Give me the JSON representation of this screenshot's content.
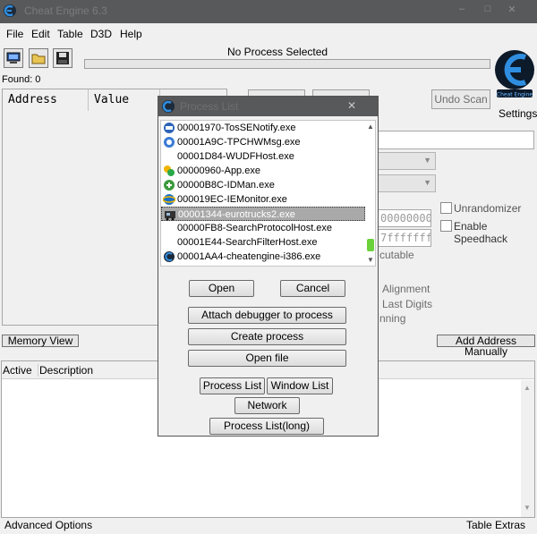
{
  "window": {
    "title": "Cheat Engine 6.3",
    "minimize": "–",
    "maximize": "□",
    "close": "✕"
  },
  "menu": [
    "File",
    "Edit",
    "Table",
    "D3D",
    "Help"
  ],
  "toolbar": {
    "open_process_icon": "computer-icon",
    "open_file_icon": "folder-icon",
    "save_icon": "floppy-icon"
  },
  "process_label": "No Process Selected",
  "found": "Found: 0",
  "results_columns": [
    "Address",
    "Value"
  ],
  "undo_scan": "Undo Scan",
  "settings": "Settings",
  "logo_text": "Cheat Engine",
  "background": {
    "hex_a": "00000000",
    "hex_b": "7fffffff",
    "executable_frag": "cutable",
    "alignment_frag": "Alignment",
    "last_digits_frag": "Last Digits",
    "scanning_frag": "nning",
    "unrandomizer": "Unrandomizer",
    "enable_speedhack": "Enable Speedhack"
  },
  "memory_view": "Memory View",
  "add_address_manually": "Add Address Manually",
  "address_list_columns": [
    "Active",
    "Description"
  ],
  "status": {
    "left": "Advanced Options",
    "right": "Table Extras"
  },
  "dialog": {
    "title": "Process List",
    "processes": [
      {
        "label": "00001970-TosSENotify.exe",
        "icon": "tos-icon",
        "selected": false
      },
      {
        "label": "00001A9C-TPCHWMsg.exe",
        "icon": "tpc-icon",
        "selected": false
      },
      {
        "label": "00001D84-WUDFHost.exe",
        "icon": "none",
        "selected": false
      },
      {
        "label": "00000960-App.exe",
        "icon": "app-icon",
        "selected": false
      },
      {
        "label": "00000B8C-IDMan.exe",
        "icon": "idm-icon",
        "selected": false
      },
      {
        "label": "000019EC-IEMonitor.exe",
        "icon": "ie-icon",
        "selected": false
      },
      {
        "label": "00001344-eurotrucks2.exe",
        "icon": "truck-icon",
        "selected": true
      },
      {
        "label": "00000FB8-SearchProtocolHost.exe",
        "icon": "none",
        "selected": false
      },
      {
        "label": "00001E44-SearchFilterHost.exe",
        "icon": "none",
        "selected": false
      },
      {
        "label": "00001AA4-cheatengine-i386.exe",
        "icon": "cheatengine-icon",
        "selected": false
      }
    ],
    "buttons": {
      "open": "Open",
      "cancel": "Cancel",
      "attach_debugger": "Attach debugger to process",
      "create_process": "Create process",
      "open_file": "Open file",
      "process_list": "Process List",
      "window_list": "Window List",
      "network": "Network",
      "process_list_long": "Process List(long)"
    }
  }
}
